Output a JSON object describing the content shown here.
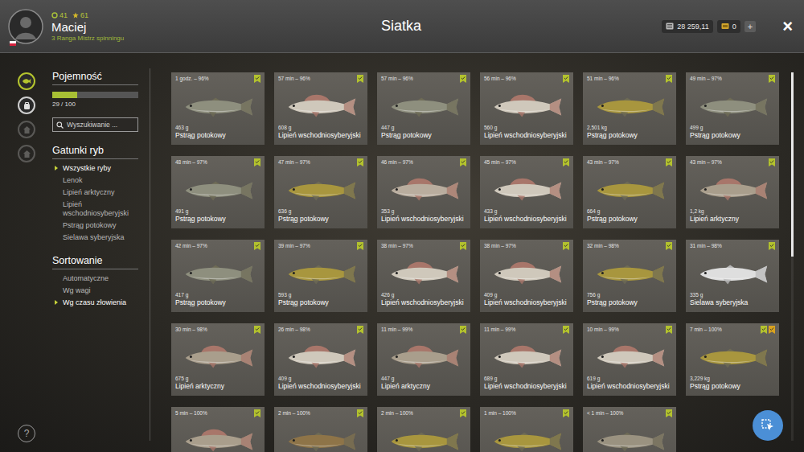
{
  "window": {
    "title": "Siatka"
  },
  "player": {
    "name": "Maciej",
    "rank": "3 Ranga Mistrz spinningu",
    "xp": "41",
    "points": "61"
  },
  "currency": {
    "silver": "28 259,11",
    "gold": "0",
    "add": "+"
  },
  "close": "×",
  "nav": [
    {
      "selected": true,
      "disabled": false
    },
    {
      "selected": false,
      "disabled": false
    },
    {
      "selected": false,
      "disabled": true
    },
    {
      "selected": false,
      "disabled": true
    }
  ],
  "capacity": {
    "title": "Pojemność",
    "level": 0.29,
    "reading": "29 / 100"
  },
  "search": {
    "placeholder": "Wyszukiwanie ..."
  },
  "species": {
    "title": "Gatunki ryb",
    "items": [
      {
        "label": "Wszystkie ryby",
        "selected": true
      },
      {
        "label": "Lenok",
        "selected": false
      },
      {
        "label": "Lipień arktyczny",
        "selected": false
      },
      {
        "label": "Lipień wschodniosyberyjski",
        "selected": false
      },
      {
        "label": "Pstrąg potokowy",
        "selected": false
      },
      {
        "label": "Sielawa syberyjska",
        "selected": false
      }
    ]
  },
  "sorting": {
    "title": "Sortowanie",
    "items": [
      {
        "label": "Automatyczne",
        "selected": false
      },
      {
        "label": "Wg wagi",
        "selected": false
      },
      {
        "label": "Wg czasu złowienia",
        "selected": true
      }
    ]
  },
  "help": "?",
  "scrollbar": {
    "level": 0.5
  },
  "catches": [
    {
      "time": "1 godz. – 96%",
      "weight": "463 g",
      "name": "Pstrąg potokowy",
      "kind": "trout",
      "color": "#8e8f7e",
      "badges": [
        {
          "color": "#b3c22e"
        }
      ]
    },
    {
      "time": "57 min – 96%",
      "weight": "608 g",
      "name": "Lipień wschodniosyberyjski",
      "kind": "grayling",
      "color": "#cfc8bb",
      "badges": [
        {
          "color": "#b3c22e"
        }
      ]
    },
    {
      "time": "57 min – 96%",
      "weight": "447 g",
      "name": "Pstrąg potokowy",
      "kind": "trout",
      "color": "#8e8f7e",
      "badges": [
        {
          "color": "#b3c22e"
        }
      ]
    },
    {
      "time": "56 min – 96%",
      "weight": "560 g",
      "name": "Lipień wschodniosyberyjski",
      "kind": "grayling",
      "color": "#cfc8bb",
      "badges": [
        {
          "color": "#b3c22e"
        }
      ]
    },
    {
      "time": "51 min – 96%",
      "weight": "2,501 kg",
      "name": "Pstrąg potokowy",
      "kind": "trout",
      "color": "#a8963e",
      "badges": [
        {
          "color": "#b3c22e"
        }
      ]
    },
    {
      "time": "49 min – 97%",
      "weight": "499 g",
      "name": "Pstrąg potokowy",
      "kind": "trout",
      "color": "#8e8f7e",
      "badges": [
        {
          "color": "#b3c22e"
        }
      ]
    },
    {
      "time": "48 min – 97%",
      "weight": "491 g",
      "name": "Pstrąg potokowy",
      "kind": "trout",
      "color": "#8e8f7e",
      "badges": [
        {
          "color": "#b3c22e"
        }
      ]
    },
    {
      "time": "47 min – 97%",
      "weight": "636 g",
      "name": "Pstrąg potokowy",
      "kind": "trout",
      "color": "#a8963e",
      "badges": [
        {
          "color": "#b3c22e"
        }
      ]
    },
    {
      "time": "46 min – 97%",
      "weight": "353 g",
      "name": "Lipień wschodniosyberyjski",
      "kind": "grayling",
      "color": "#b9ad9e",
      "badges": [
        {
          "color": "#b3c22e"
        }
      ]
    },
    {
      "time": "45 min – 97%",
      "weight": "433 g",
      "name": "Lipień wschodniosyberyjski",
      "kind": "grayling",
      "color": "#cfc8bb",
      "badges": [
        {
          "color": "#b3c22e"
        }
      ]
    },
    {
      "time": "43 min – 97%",
      "weight": "664 g",
      "name": "Pstrąg potokowy",
      "kind": "trout",
      "color": "#a8963e",
      "badges": [
        {
          "color": "#b3c22e"
        }
      ]
    },
    {
      "time": "43 min – 97%",
      "weight": "1,2 kg",
      "name": "Lipień arktyczny",
      "kind": "grayling",
      "color": "#a99e8c",
      "badges": [
        {
          "color": "#b3c22e"
        }
      ]
    },
    {
      "time": "42 min – 97%",
      "weight": "417 g",
      "name": "Pstrąg potokowy",
      "kind": "trout",
      "color": "#8e8f7e",
      "badges": [
        {
          "color": "#b3c22e"
        }
      ]
    },
    {
      "time": "39 min – 97%",
      "weight": "593 g",
      "name": "Pstrąg potokowy",
      "kind": "trout",
      "color": "#a8963e",
      "badges": [
        {
          "color": "#b3c22e"
        }
      ]
    },
    {
      "time": "38 min – 97%",
      "weight": "426 g",
      "name": "Lipień wschodniosyberyjski",
      "kind": "grayling",
      "color": "#cfc8bb",
      "badges": [
        {
          "color": "#b3c22e"
        }
      ]
    },
    {
      "time": "38 min – 97%",
      "weight": "409 g",
      "name": "Lipień wschodniosyberyjski",
      "kind": "grayling",
      "color": "#cfc8bb",
      "badges": [
        {
          "color": "#b3c22e"
        }
      ]
    },
    {
      "time": "32 min – 98%",
      "weight": "756 g",
      "name": "Pstrąg potokowy",
      "kind": "trout",
      "color": "#a8963e",
      "badges": [
        {
          "color": "#b3c22e"
        }
      ]
    },
    {
      "time": "31 min – 98%",
      "weight": "335 g",
      "name": "Sielawa syberyjska",
      "kind": "whitefish",
      "color": "#dedede",
      "badges": [
        {
          "color": "#b3c22e"
        }
      ]
    },
    {
      "time": "30 min – 98%",
      "weight": "675 g",
      "name": "Lipień arktyczny",
      "kind": "grayling",
      "color": "#a99e8c",
      "badges": [
        {
          "color": "#b3c22e"
        }
      ]
    },
    {
      "time": "26 min – 98%",
      "weight": "409 g",
      "name": "Lipień wschodniosyberyjski",
      "kind": "grayling",
      "color": "#cfc8bb",
      "badges": [
        {
          "color": "#b3c22e"
        }
      ]
    },
    {
      "time": "11 min – 99%",
      "weight": "447 g",
      "name": "Lipień arktyczny",
      "kind": "grayling",
      "color": "#a99e8c",
      "badges": [
        {
          "color": "#b3c22e"
        }
      ]
    },
    {
      "time": "11 min – 99%",
      "weight": "689 g",
      "name": "Lipień wschodniosyberyjski",
      "kind": "grayling",
      "color": "#cfc8bb",
      "badges": [
        {
          "color": "#b3c22e"
        }
      ]
    },
    {
      "time": "10 min – 99%",
      "weight": "619 g",
      "name": "Lipień wschodniosyberyjski",
      "kind": "grayling",
      "color": "#cfc8bb",
      "badges": [
        {
          "color": "#b3c22e"
        }
      ]
    },
    {
      "time": "7 min – 100%",
      "weight": "3,229 kg",
      "name": "Pstrąg potokowy",
      "kind": "trout",
      "color": "#a8963e",
      "badges": [
        {
          "color": "#b3c22e"
        },
        {
          "color": "#d9a21f"
        }
      ]
    },
    {
      "time": "5 min – 100%",
      "kind": "grayling",
      "color": "#a99e8c",
      "badges": [
        {
          "color": "#b3c22e"
        }
      ]
    },
    {
      "time": "2 min – 100%",
      "kind": "trout",
      "color": "#8e7448",
      "badges": [
        {
          "color": "#b3c22e"
        }
      ]
    },
    {
      "time": "2 min – 100%",
      "kind": "trout",
      "color": "#a8963e",
      "badges": [
        {
          "color": "#b3c22e"
        }
      ]
    },
    {
      "time": "1 min – 100%",
      "kind": "trout",
      "color": "#a8963e",
      "badges": [
        {
          "color": "#b3c22e"
        }
      ]
    },
    {
      "time": "< 1 min – 100%",
      "kind": "trout",
      "color": "#9a9280",
      "badges": [
        {
          "color": "#b3c22e"
        }
      ]
    }
  ]
}
